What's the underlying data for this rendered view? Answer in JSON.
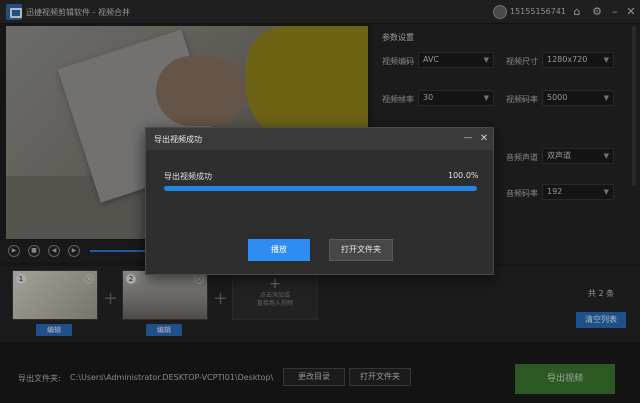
{
  "titlebar": {
    "title": "迅捷视频剪辑软件 - 视频合并",
    "user_phone": "15155156741",
    "icons": [
      "home-icon",
      "settings-icon",
      "minimize-icon",
      "close-icon"
    ]
  },
  "player": {
    "controls": [
      "play-icon",
      "stop-icon",
      "prev-icon",
      "next-icon"
    ]
  },
  "params": {
    "section_title": "参数设置",
    "video_codec_label": "视频编码",
    "video_codec_value": "AVC",
    "video_size_label": "视频尺寸",
    "video_size_value": "1280x720",
    "frame_rate_label": "视频帧率",
    "frame_rate_value": "30",
    "video_bitrate_label": "视频码率",
    "video_bitrate_value": "5000",
    "audio_channel_label": "音频声道",
    "audio_channel_value": "双声道",
    "audio_bitrate_label": "音频码率",
    "audio_bitrate_value": "192"
  },
  "clips": {
    "items": [
      {
        "num": "1",
        "edit_label": "编辑"
      },
      {
        "num": "2",
        "edit_label": "编辑"
      }
    ],
    "add_line1": "点击添加或",
    "add_line2": "直接拖入视频",
    "count_text": "共 2 条",
    "clear_label": "清空列表"
  },
  "output": {
    "label": "导出文件夹:",
    "path": "C:\\Users\\Administrator.DESKTOP-VCPTI01\\Desktop\\",
    "change_dir_label": "更改目录",
    "open_folder_label": "打开文件夹",
    "export_label": "导出视频"
  },
  "dialog": {
    "title": "导出视频成功",
    "message": "导出视频成功",
    "percent_text": "100.0%",
    "progress": 1.0,
    "play_label": "播放",
    "open_folder_label": "打开文件夹"
  },
  "colors": {
    "accent_blue": "#2f8cf2",
    "export_green": "#3e7b32"
  }
}
